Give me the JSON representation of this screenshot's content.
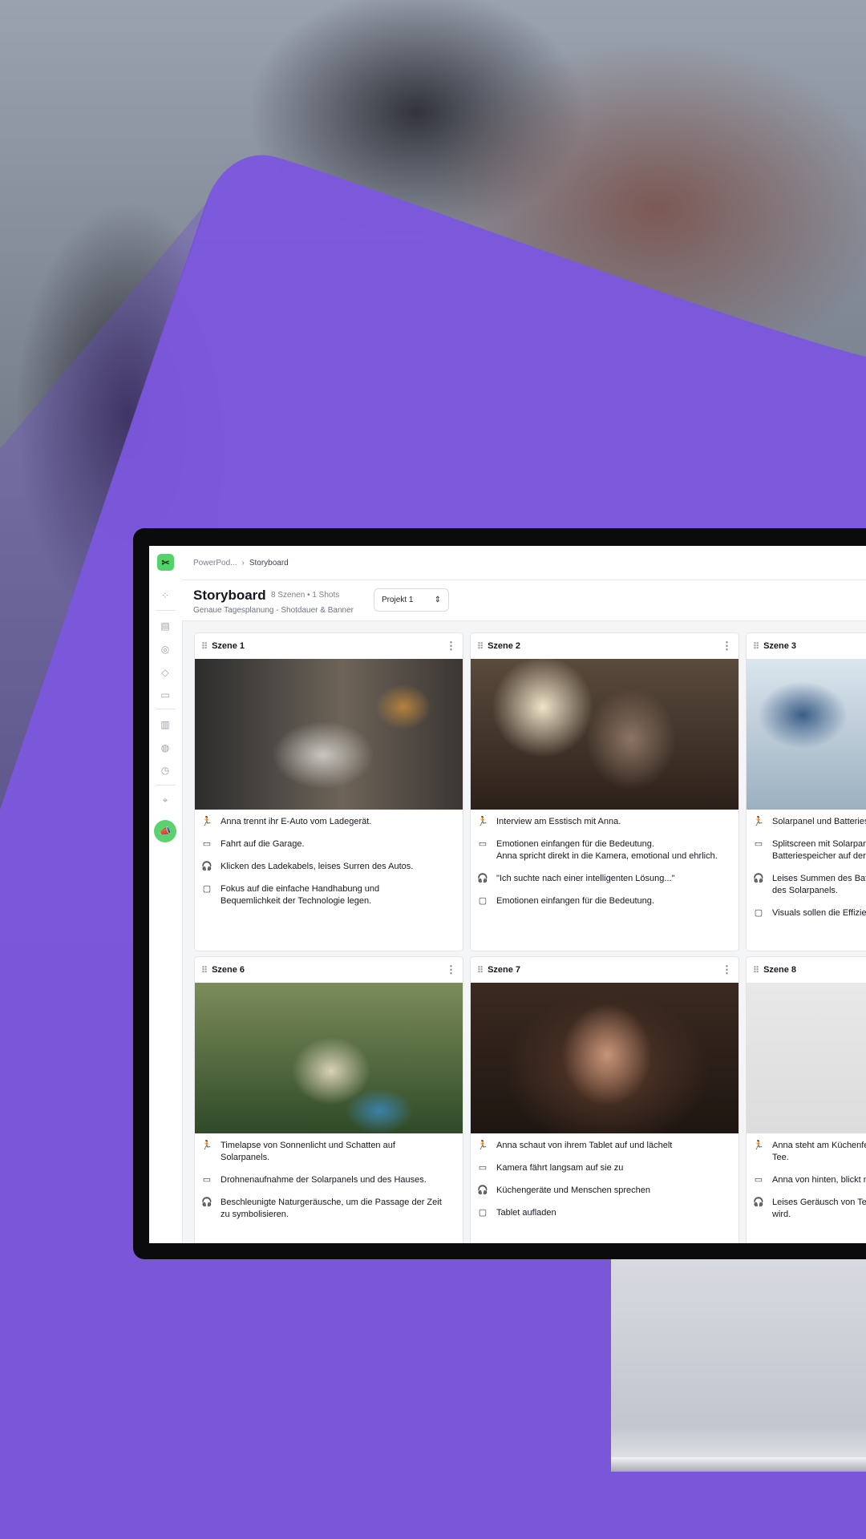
{
  "breadcrumb": {
    "project": "PowerPod...",
    "current": "Storyboard"
  },
  "header": {
    "title": "Storyboard",
    "meta": "8 Szenen • 1 Shots",
    "subtitle": "Genaue Tagesplanung - Shotdauer & Banner",
    "project_select": "Projekt 1"
  },
  "icons": {
    "action": "action-icon",
    "camera": "camera-icon",
    "audio": "headphones-icon",
    "note": "note-icon",
    "sidebar": [
      "grid-icon",
      "notes-icon",
      "check-circle-icon",
      "layers-icon",
      "folder-icon",
      "book-icon",
      "palette-icon",
      "clock-icon",
      "map-pin-icon"
    ],
    "action_button": "megaphone-icon"
  },
  "colors": {
    "brand_green": "#54d36b",
    "purple": "#7b5cd6"
  },
  "scenes": [
    {
      "title": "Szene 1",
      "action": "Anna trennt ihr E-Auto vom Ladegerät.",
      "camera": "Fahrt auf die Garage.",
      "audio": "Klicken des Ladekabels, leises Surren des Autos.",
      "note": "Fokus auf die einfache Handhabung und\nBequemlichkeit der Technologie legen."
    },
    {
      "title": "Szene 2",
      "action": "Interview am Esstisch mit Anna.",
      "camera": "Emotionen einfangen für die Bedeutung.\nAnna spricht direkt in die Kamera, emotional und ehrlich.",
      "audio": "\"Ich suchte nach einer intelligenten Lösung...\"",
      "note": "Emotionen einfangen für die Bedeutung."
    },
    {
      "title": "Szene 3",
      "action": "Solarpanel und Batteries",
      "camera": "Splitscreen mit Solarpan\nBatteriespeicher auf der",
      "audio": "Leises Summen des Batt\ndes Solarpanels.",
      "note": "Visuals sollen die Effizien"
    },
    {
      "title": "Szene 6",
      "action": "Timelapse von Sonnenlicht und Schatten auf\nSolarpanels.",
      "camera": "Drohnenaufnahme der Solarpanels und des Hauses.",
      "audio": "Beschleunigte Naturgeräusche, um die Passage der Zeit\nzu symbolisieren.",
      "note": ""
    },
    {
      "title": "Szene 7",
      "action": "Anna schaut von ihrem Tablet auf und lächelt",
      "camera": "Kamera fährt langsam auf sie zu",
      "audio": "Küchengeräte und Menschen sprechen",
      "note": "Tablet aufladen"
    },
    {
      "title": "Szene 8",
      "action": "Anna steht am Küchenfe\nTee.",
      "camera": "Anna von hinten, blickt n",
      "audio": "Leises Geräusch von Tee\nwird.",
      "note": ""
    }
  ]
}
